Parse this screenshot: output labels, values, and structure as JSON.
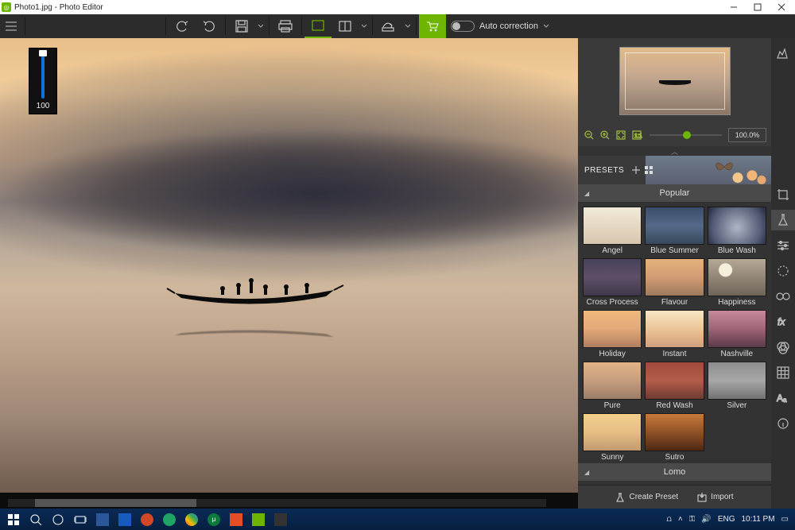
{
  "window": {
    "title": "Photo1.jpg - Photo Editor"
  },
  "toolbar": {
    "auto_correction": "Auto correction"
  },
  "slider": {
    "value": "100"
  },
  "zoom": {
    "value": "100.0%"
  },
  "presets": {
    "title": "PRESETS",
    "group_popular": "Popular",
    "group_lomo": "Lomo",
    "items": [
      {
        "id": "angel",
        "label": "Angel",
        "thumb": "t-angel"
      },
      {
        "id": "blue-summer",
        "label": "Blue Summer",
        "thumb": "t-blue-summer"
      },
      {
        "id": "blue-wash",
        "label": "Blue Wash",
        "thumb": "t-blue-wash"
      },
      {
        "id": "cross-process",
        "label": "Cross Process",
        "thumb": "t-cross-process"
      },
      {
        "id": "flavour",
        "label": "Flavour",
        "thumb": "t-flavour"
      },
      {
        "id": "happiness",
        "label": "Happiness",
        "thumb": "t-happiness"
      },
      {
        "id": "holiday",
        "label": "Holiday",
        "thumb": "t-holiday"
      },
      {
        "id": "instant",
        "label": "Instant",
        "thumb": "t-instant"
      },
      {
        "id": "nashville",
        "label": "Nashville",
        "thumb": "t-nashville"
      },
      {
        "id": "pure",
        "label": "Pure",
        "thumb": "t-pure"
      },
      {
        "id": "red-wash",
        "label": "Red Wash",
        "thumb": "t-red-wash"
      },
      {
        "id": "silver",
        "label": "Silver",
        "thumb": "t-silver"
      },
      {
        "id": "sunny",
        "label": "Sunny",
        "thumb": "t-sunny"
      },
      {
        "id": "sutro",
        "label": "Sutro",
        "thumb": "t-sutro"
      }
    ],
    "create": "Create Preset",
    "import": "Import"
  },
  "taskbar": {
    "lang": "ENG",
    "time": "10:11 PM"
  }
}
